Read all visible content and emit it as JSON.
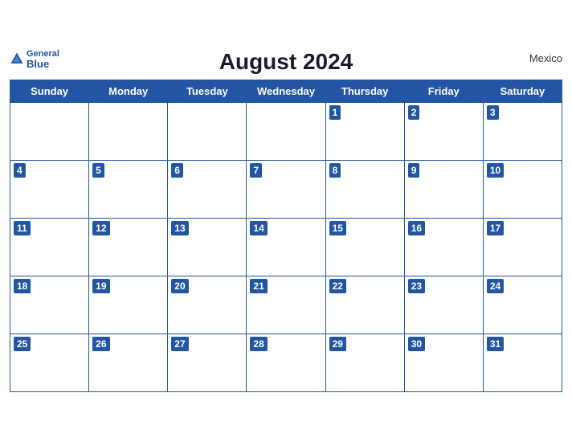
{
  "header": {
    "logo_general": "General",
    "logo_blue": "Blue",
    "title": "August 2024",
    "country": "Mexico"
  },
  "weekdays": [
    "Sunday",
    "Monday",
    "Tuesday",
    "Wednesday",
    "Thursday",
    "Friday",
    "Saturday"
  ],
  "weeks": [
    [
      null,
      null,
      null,
      null,
      1,
      2,
      3
    ],
    [
      4,
      5,
      6,
      7,
      8,
      9,
      10
    ],
    [
      11,
      12,
      13,
      14,
      15,
      16,
      17
    ],
    [
      18,
      19,
      20,
      21,
      22,
      23,
      24
    ],
    [
      25,
      26,
      27,
      28,
      29,
      30,
      31
    ]
  ]
}
